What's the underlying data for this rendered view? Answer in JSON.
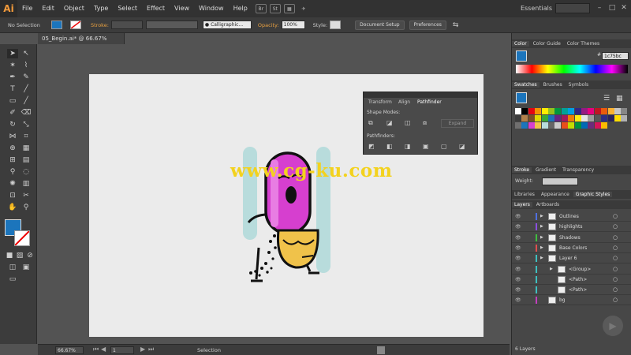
{
  "app": {
    "logo": "Ai"
  },
  "menu": [
    "File",
    "Edit",
    "Object",
    "Type",
    "Select",
    "Effect",
    "View",
    "Window",
    "Help"
  ],
  "menu_badges": [
    "Br",
    "St"
  ],
  "workspace": "Essentials",
  "control": {
    "selection": "No Selection",
    "stroke_label": "Stroke:",
    "brush": "Calligraphic...",
    "opacity_label": "Opacity:",
    "opacity_value": "100%",
    "style_label": "Style:",
    "doc_setup": "Document Setup",
    "preferences": "Preferences"
  },
  "document_tab": "05_Begin.ai* @ 66.67% (RGB/GPU Preview)",
  "pathfinder": {
    "tabs": [
      "Transform",
      "Align",
      "Pathfinder"
    ],
    "shape_modes": "Shape Modes:",
    "expand": "Expand",
    "pathfinders": "Pathfinders:"
  },
  "color_panel": {
    "tabs": [
      "Color",
      "Color Guide",
      "Color Themes"
    ],
    "hex": "1c75bc"
  },
  "swatch_panel": {
    "tabs": [
      "Swatches",
      "Brushes",
      "Symbols"
    ]
  },
  "stroke_panel": {
    "tabs": [
      "Stroke",
      "Gradient",
      "Transparency"
    ],
    "weight_label": "Weight:"
  },
  "library_panel": {
    "tabs": [
      "Libraries",
      "Appearance",
      "Graphic Styles"
    ]
  },
  "layers_panel": {
    "tabs": [
      "Layers",
      "Artboards"
    ],
    "rows": [
      {
        "name": "Outlines",
        "color": "#4f6fe0",
        "indent": 0,
        "expand": true
      },
      {
        "name": "highlights",
        "color": "#8a4fe0",
        "indent": 0,
        "expand": true
      },
      {
        "name": "Shadows",
        "color": "#3fbf3f",
        "indent": 0,
        "expand": true
      },
      {
        "name": "Base Colors",
        "color": "#e04f4f",
        "indent": 0,
        "expand": true
      },
      {
        "name": "Layer 6",
        "color": "#3fbfbf",
        "indent": 0,
        "expand": true
      },
      {
        "name": "<Group>",
        "color": "#3fbfbf",
        "indent": 1,
        "expand": true
      },
      {
        "name": "<Path>",
        "color": "#3fbfbf",
        "indent": 1,
        "expand": false
      },
      {
        "name": "<Path>",
        "color": "#3fbfbf",
        "indent": 1,
        "expand": false
      },
      {
        "name": "bg",
        "color": "#c43fbf",
        "indent": 0,
        "expand": false
      }
    ],
    "count": "6 Layers"
  },
  "status": {
    "zoom": "66.67%",
    "artboard": "1",
    "tool": "Selection"
  },
  "watermark": "www.cg-ku.com",
  "colors": {
    "fill": "#1c75bc",
    "pill": "#d63fcf",
    "seed": "#f0c24a",
    "teal": "#b8dcdc"
  }
}
